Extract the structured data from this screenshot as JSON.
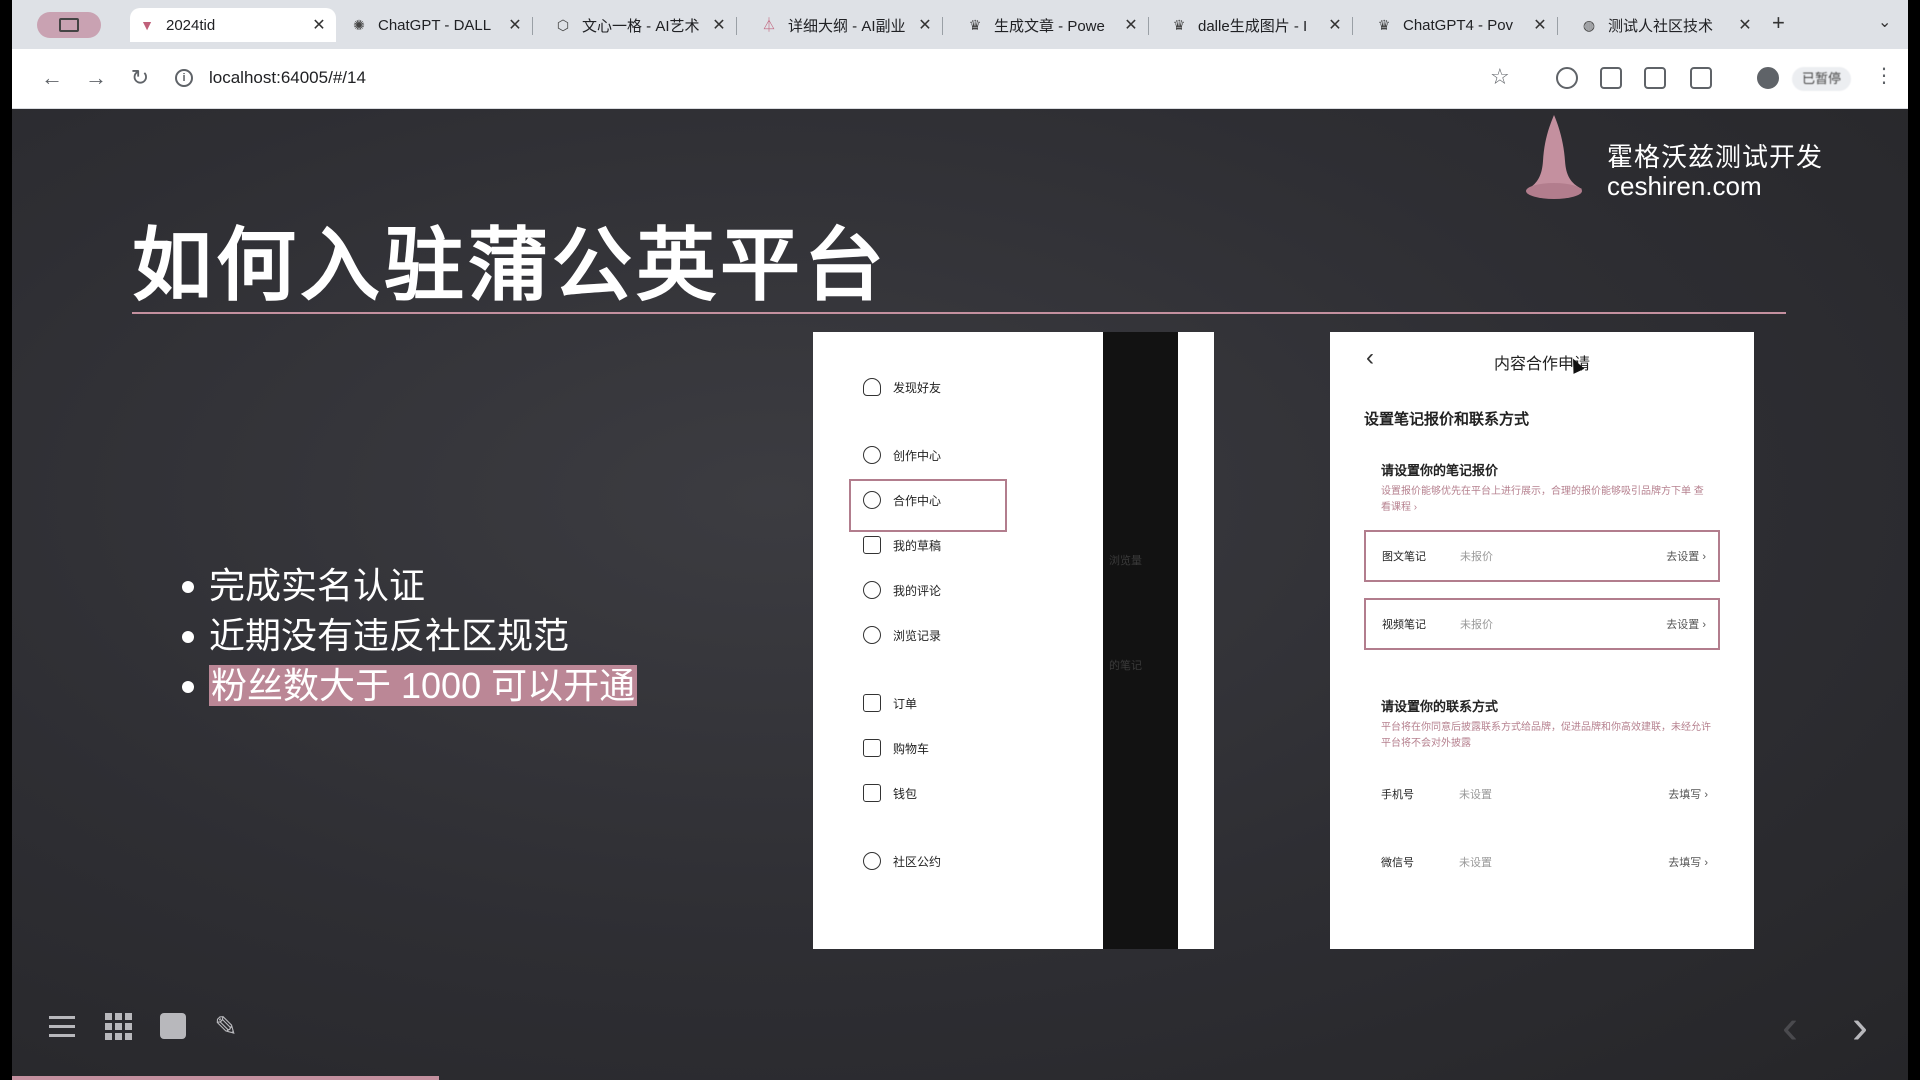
{
  "browser": {
    "tabs": [
      {
        "title": "2024tid",
        "icon": "gitlab-fox-icon",
        "active": true
      },
      {
        "title": "ChatGPT - DALL",
        "icon": "openai-icon"
      },
      {
        "title": "文心一格 - AI艺术",
        "icon": "cube-icon"
      },
      {
        "title": "详细大纲 - AI副业",
        "icon": "flask-icon"
      },
      {
        "title": "生成文章 - Powe",
        "icon": "crown-icon"
      },
      {
        "title": "dalle生成图片 - I",
        "icon": "crown-icon"
      },
      {
        "title": "ChatGPT4 - Pov",
        "icon": "crown-icon"
      },
      {
        "title": "测试人社区技术",
        "icon": "globe-icon"
      }
    ],
    "close_glyph": "✕",
    "new_tab_glyph": "+",
    "url": "localhost:64005/#/14",
    "profile_label": "已暂停"
  },
  "slide": {
    "brand_cn": "霍格沃兹测试开发",
    "brand_en": "ceshiren.com",
    "title": "如何入驻蒲公英平台",
    "bullets": [
      "完成实名认证",
      "近期没有违反社区规范",
      "粉丝数大于 1000 可以开通"
    ],
    "accent_color": "#c4909f",
    "progress_fraction": 0.225
  },
  "panel1": {
    "menu": [
      {
        "label": "发现好友",
        "icon": "person-add-icon"
      },
      {
        "label": "创作中心",
        "icon": "bulb-icon"
      },
      {
        "label": "合作中心",
        "icon": "handshake-icon"
      },
      {
        "label": "我的草稿",
        "icon": "draft-box-icon"
      },
      {
        "label": "我的评论",
        "icon": "comment-icon"
      },
      {
        "label": "浏览记录",
        "icon": "clock-icon"
      },
      {
        "label": "订单",
        "icon": "order-icon"
      },
      {
        "label": "购物车",
        "icon": "cart-icon"
      },
      {
        "label": "钱包",
        "icon": "wallet-icon"
      },
      {
        "label": "社区公约",
        "icon": "sprout-icon"
      }
    ],
    "ghost_text_1": "浏览量",
    "ghost_text_2": "的笔记"
  },
  "panel2": {
    "back_glyph": "‹",
    "title": "内容合作申请",
    "heading": "设置笔记报价和联系方式",
    "price_heading": "请设置你的笔记报价",
    "price_desc": "设置报价能够优先在平台上进行展示，合理的报价能够吸引品牌方下单 查看课程 ›",
    "price_rows": [
      {
        "label": "图文笔记",
        "value": "未报价",
        "action": "去设置 ›"
      },
      {
        "label": "视频笔记",
        "value": "未报价",
        "action": "去设置 ›"
      }
    ],
    "contact_heading": "请设置你的联系方式",
    "contact_desc": "平台将在你同意后披露联系方式给品牌，促进品牌和你高效建联，未经允许平台将不会对外披露",
    "contact_rows": [
      {
        "label": "手机号",
        "value": "未设置",
        "action": "去填写 ›"
      },
      {
        "label": "微信号",
        "value": "未设置",
        "action": "去填写 ›"
      }
    ]
  },
  "controls": {
    "prev_glyph": "‹",
    "next_glyph": "›",
    "pencil_glyph": "✎"
  }
}
